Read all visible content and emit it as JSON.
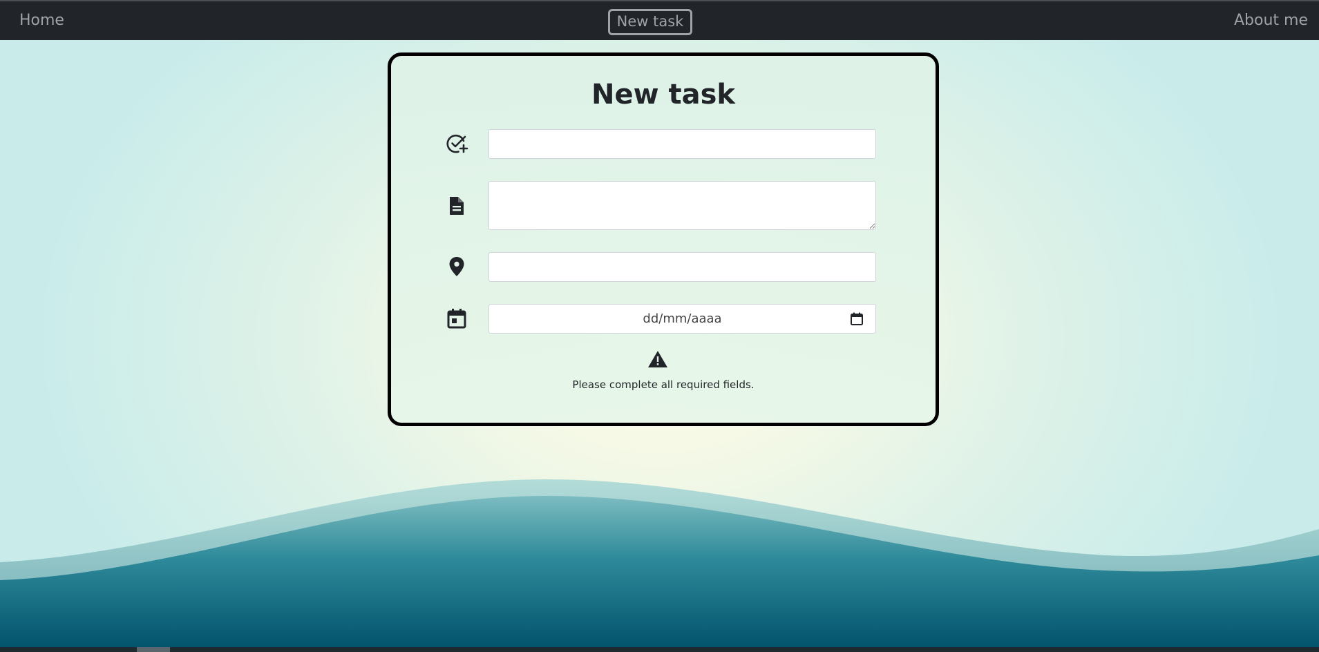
{
  "navbar": {
    "home": "Home",
    "new_task": "New task",
    "about": "About me"
  },
  "form": {
    "title": "New task",
    "date_placeholder": "dd/mm/aaaa",
    "warning": "Please complete all required fields."
  },
  "icons": {
    "title": "check-circle-plus-icon",
    "description": "file-text-icon",
    "location": "map-pin-icon",
    "date": "calendar-icon",
    "warning": "warning-triangle-icon"
  },
  "colors": {
    "navbar": "#212529",
    "card_border": "#000000",
    "wave_top": "#7ab9bf",
    "wave_bottom": "#00506a"
  }
}
